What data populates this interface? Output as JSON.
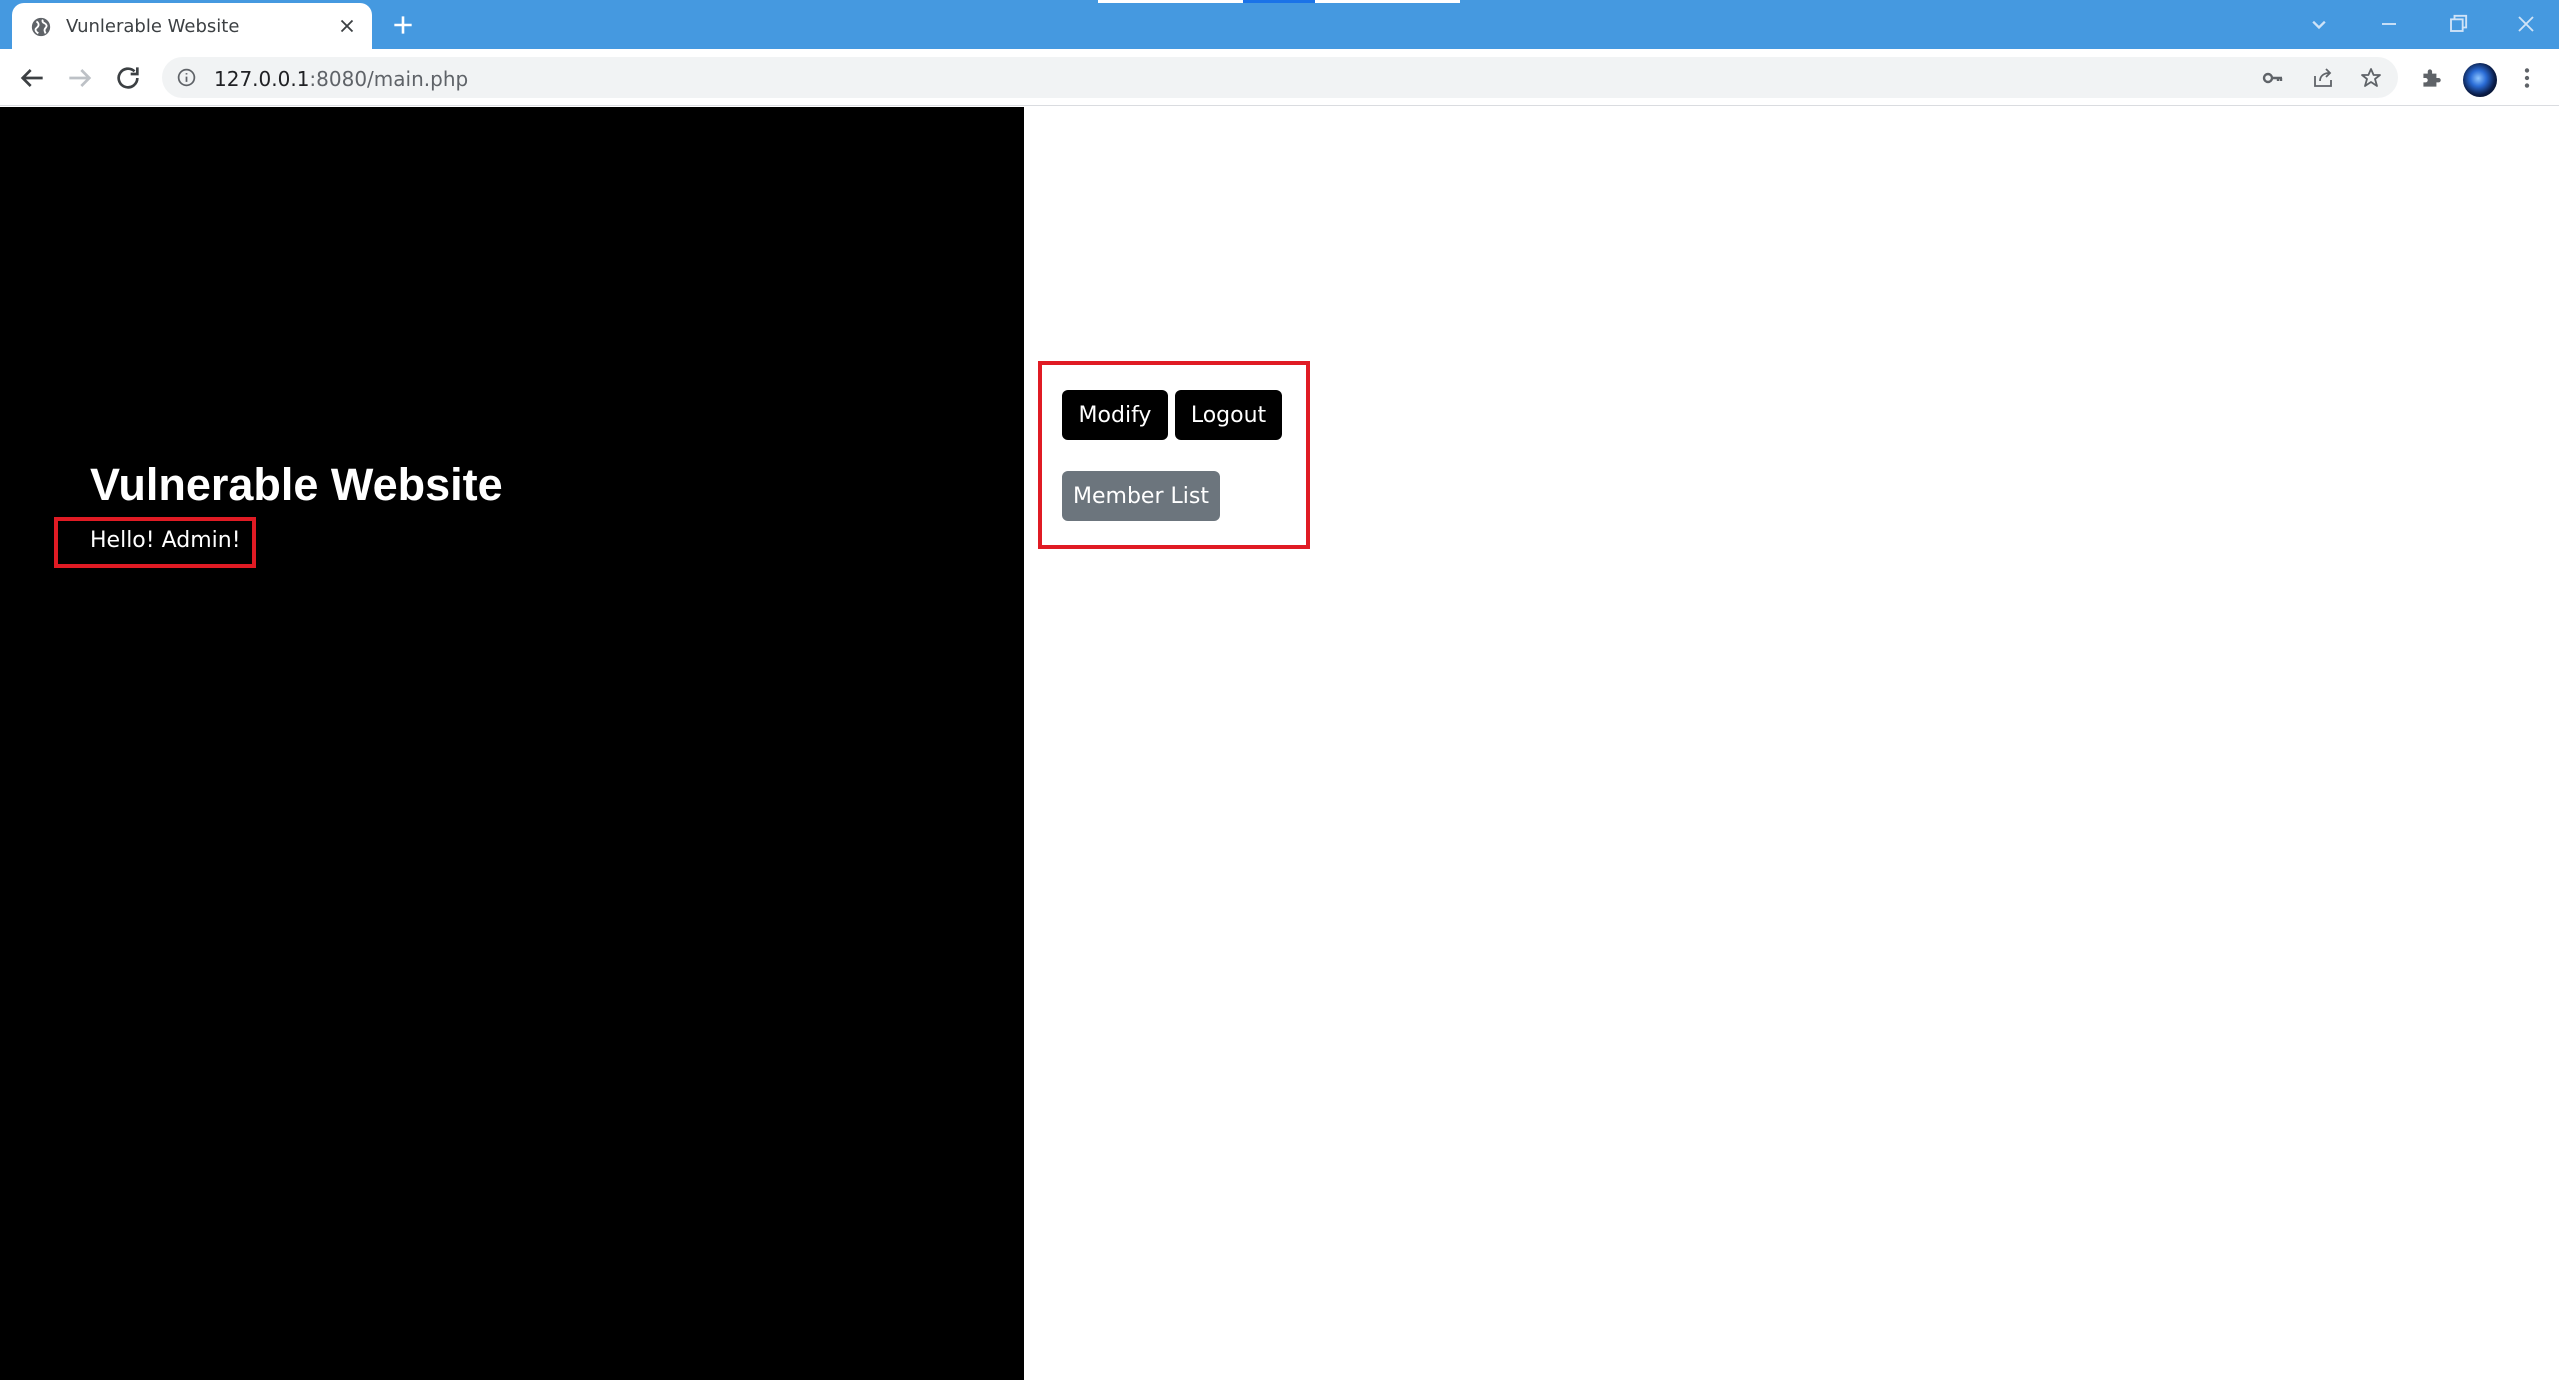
{
  "browser": {
    "tab": {
      "title": "Vunlerable Website"
    },
    "address_bar": {
      "host": "127.0.0.1",
      "port_path": ":8080/main.php"
    },
    "colors": {
      "tab_strip": "#4599e0",
      "omnibox": "#f1f3f4"
    }
  },
  "page": {
    "site_title": "Vulnerable Website",
    "greeting": "Hello! Admin!",
    "buttons": {
      "modify": "Modify",
      "logout": "Logout",
      "member_list": "Member List"
    },
    "colors": {
      "left_panel": "#000000",
      "annotation_box": "#e01b24",
      "dark_button": "#000000",
      "secondary_button": "#6c757d"
    }
  }
}
